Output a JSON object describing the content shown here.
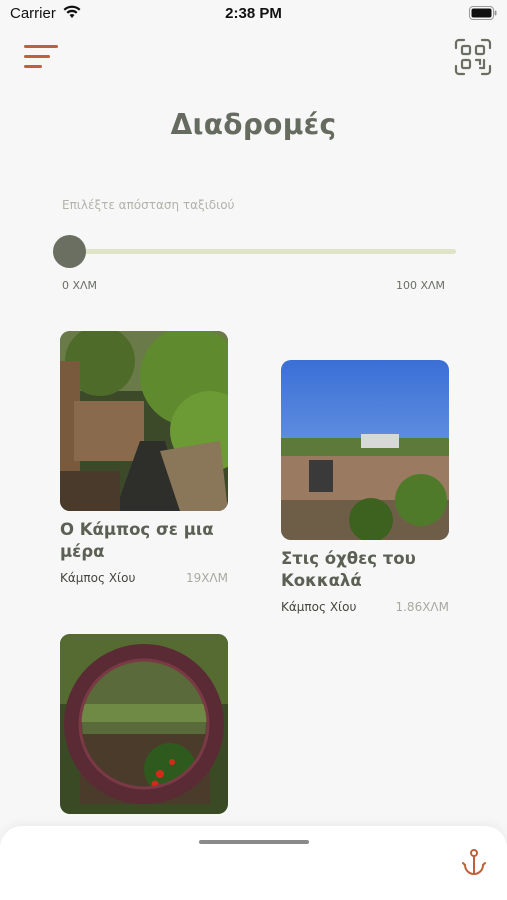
{
  "status_bar": {
    "carrier": "Carrier",
    "time": "2:38 PM"
  },
  "header": {
    "menu_icon": "menu-lines-icon",
    "qr_icon": "qr-code-icon"
  },
  "page": {
    "title": "Διαδρομές"
  },
  "slider": {
    "label": "Επιλέξτε απόσταση ταξιδιού",
    "min_label": "0 ΧΛΜ",
    "max_label": "100 ΧΛΜ",
    "value_fraction": 0.0
  },
  "routes": [
    {
      "title": "Ο Κάμπος σε μια μέρα",
      "location": "Κάμπος Χίου",
      "distance": "19ΧΛΜ"
    },
    {
      "title": "Στις όχθες του Κοκκαλά",
      "location": "Κάμπος Χίου",
      "distance": "1.86ΧΛΜ"
    },
    {
      "title": "",
      "location": "",
      "distance": ""
    }
  ],
  "bottom_sheet": {
    "anchor_icon": "anchor-icon"
  },
  "colors": {
    "accent": "#c0603a",
    "title": "#666b5f",
    "slider_thumb": "#6a6f61",
    "slider_track": "#dfe3c8"
  }
}
